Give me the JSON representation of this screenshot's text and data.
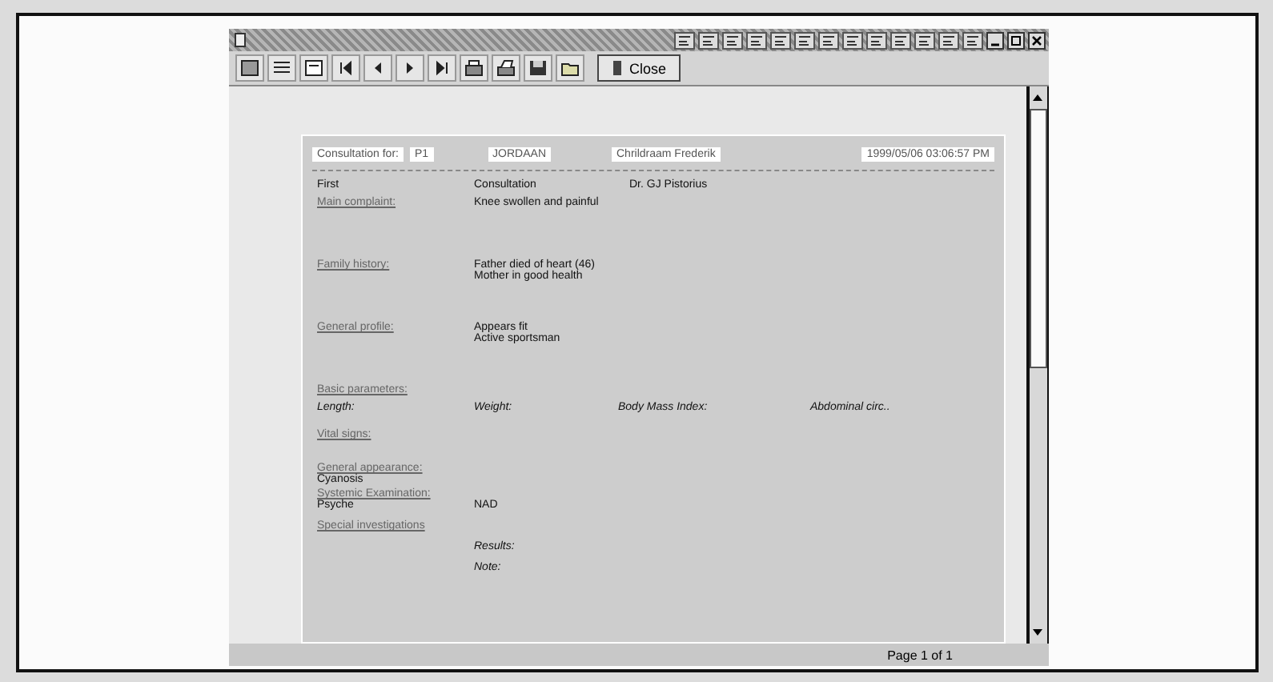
{
  "toolbar": {
    "close_button": "Close"
  },
  "report": {
    "header": [
      {
        "text": "Consultation for:"
      },
      {
        "text": "P1"
      },
      {
        "text": "JORDAAN"
      },
      {
        "text": "Chrildraam Frederik"
      },
      {
        "text": "1999/05/06 03:06:57 PM"
      }
    ],
    "intro": [
      "First",
      "Consultation",
      "Dr. GJ Pistorius"
    ],
    "sections": [
      {
        "kind": "section",
        "label": "Main complaint:",
        "lines": [
          "Knee swollen and painful"
        ]
      },
      {
        "kind": "section",
        "label": "Family history:",
        "lines": [
          "Father died of heart (46)",
          "Mother in good health"
        ]
      },
      {
        "kind": "section",
        "label": "General profile:",
        "lines": [
          "Appears fit",
          "Active sportsman"
        ]
      },
      {
        "kind": "params",
        "label": "Basic parameters:",
        "fields": [
          "Length:",
          "Weight:",
          "Body Mass Index:",
          "Abdominal circ.."
        ]
      },
      {
        "kind": "heading",
        "label": "Vital signs:"
      },
      {
        "kind": "block",
        "label": "General appearance:",
        "lines": [
          "Cyanosis"
        ]
      },
      {
        "kind": "pair",
        "label": "Systemic Examination:",
        "name": "Psyche",
        "value": "NAD"
      },
      {
        "kind": "notes",
        "label": "Special investigations",
        "fields": [
          "Results:",
          "Note:"
        ]
      }
    ]
  },
  "status_bar": {
    "page": "Page 1 of 1"
  }
}
